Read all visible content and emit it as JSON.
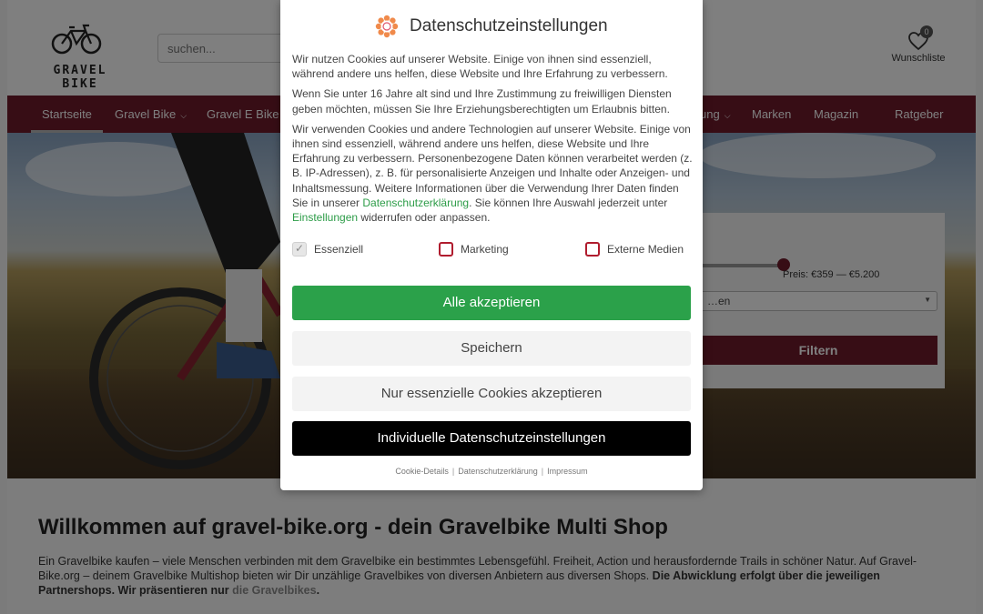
{
  "header": {
    "logo_text": "GRAVEL BIKE",
    "search_placeholder": "suchen...",
    "wishlist_label": "Wunschliste",
    "wishlist_count": "0"
  },
  "nav": {
    "items": [
      {
        "label": "Startseite",
        "active": true
      },
      {
        "label": "Gravel Bike",
        "chevron": true
      },
      {
        "label": "Gravel E Bike",
        "chevron": true
      },
      {
        "label": "…ung",
        "chevron": true
      },
      {
        "label": "Marken"
      },
      {
        "label": "Magazin"
      },
      {
        "label": "Ratgeber"
      }
    ]
  },
  "filter": {
    "price_label": "Preis: €359 — €5.200",
    "select_value": "…en",
    "button_label": "Filtern"
  },
  "content": {
    "title": "Willkommen auf gravel-bike.org - dein Gravelbike Multi Shop",
    "text_plain": "Ein Gravelbike kaufen – viele Menschen verbinden mit dem Gravelbike ein bestimmtes Lebensgefühl. Freiheit, Action und herausfordernde Trails in schöner Natur. Auf Gravel-Bike.org – deinem Gravelbike Multishop bieten wir Dir unzählige Gravelbikes von diversen Anbietern aus diversen Shops. ",
    "text_bold": "Die Abwicklung erfolgt über die jeweiligen Partnershops. Wir präsentieren nur ",
    "text_link": "die Gravelbikes",
    "text_end": "."
  },
  "modal": {
    "title": "Datenschutzeinstellungen",
    "paragraph1": "Wir nutzen Cookies auf unserer Website. Einige von ihnen sind essenziell, während andere uns helfen, diese Website und Ihre Erfahrung zu verbessern.",
    "paragraph2": "Wenn Sie unter 16 Jahre alt sind und Ihre Zustimmung zu freiwilligen Diensten geben möchten, müssen Sie Ihre Erziehungsberechtigten um Erlaubnis bitten.",
    "paragraph3_a": "Wir verwenden Cookies und andere Technologien auf unserer Website. Einige von ihnen sind essenziell, während andere uns helfen, diese Website und Ihre Erfahrung zu verbessern. Personenbezogene Daten können verarbeitet werden (z. B. IP-Adressen), z. B. für personalisierte Anzeigen und Inhalte oder Anzeigen- und Inhaltsmessung. Weitere Informationen über die Verwendung Ihrer Daten finden Sie in unserer ",
    "paragraph3_link1": "Datenschutzerklärung",
    "paragraph3_b": ". Sie können Ihre Auswahl jederzeit unter ",
    "paragraph3_link2": "Einstellungen",
    "paragraph3_c": " widerrufen oder anpassen.",
    "consents": [
      {
        "label": "Essenziell",
        "checked": true
      },
      {
        "label": "Marketing",
        "checked": false
      },
      {
        "label": "Externe Medien",
        "checked": false
      }
    ],
    "buttons": {
      "accept_all": "Alle akzeptieren",
      "save": "Speichern",
      "essential_only": "Nur essenzielle Cookies akzeptieren",
      "individual": "Individuelle Datenschutzeinstellungen"
    },
    "footer_links": [
      "Cookie-Details",
      "Datenschutzerklärung",
      "Impressum"
    ],
    "footer_separator": "|"
  },
  "colors": {
    "nav_bg": "#6e1a2b",
    "accept_green": "#2ba14a",
    "link_green": "#2c9c47",
    "checkbox_red": "#b01c2e"
  }
}
